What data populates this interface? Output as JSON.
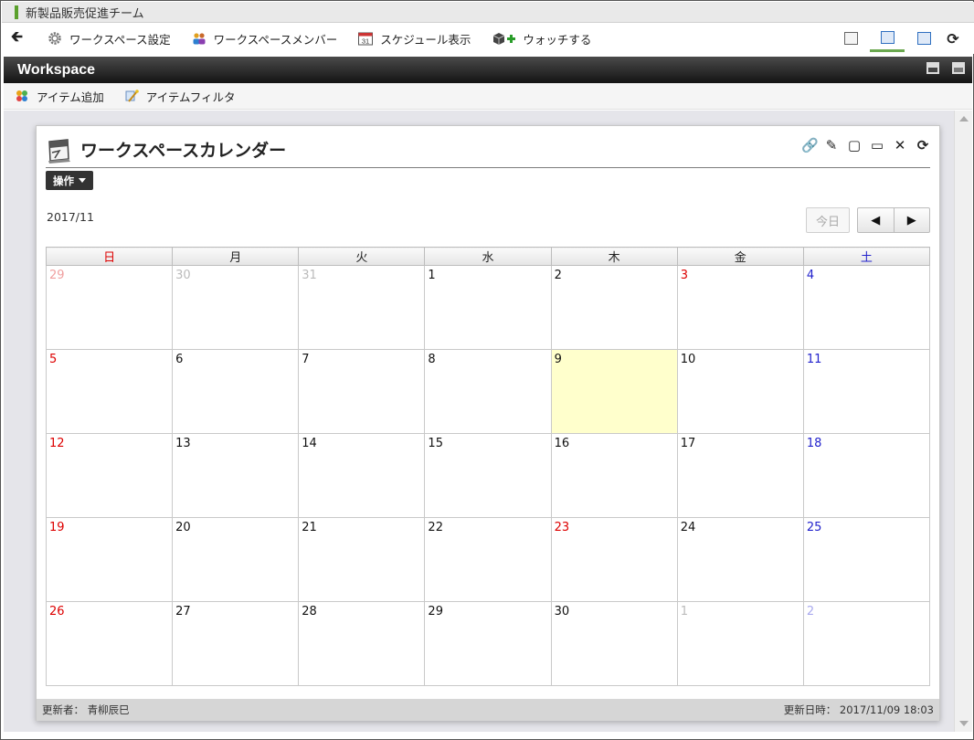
{
  "window": {
    "title": "新製品販売促進チーム"
  },
  "toolbar": {
    "items": [
      {
        "label": "ワークスペース設定"
      },
      {
        "label": "ワークスペースメンバー"
      },
      {
        "label": "スケジュール表示"
      },
      {
        "label": "ウォッチする"
      }
    ],
    "calendar_icon_day": "31"
  },
  "workspace": {
    "title": "Workspace",
    "tools": [
      {
        "label": "アイテム追加"
      },
      {
        "label": "アイテムフィルタ"
      }
    ]
  },
  "portlet": {
    "title": "ワークスペースカレンダー",
    "ops_label": "操作",
    "month_label": "2017/11",
    "today_label": "今日",
    "prev_symbol": "◀",
    "next_symbol": "▶",
    "weekdays": [
      "日",
      "月",
      "火",
      "水",
      "木",
      "金",
      "土"
    ],
    "weeks": [
      [
        {
          "day": "29",
          "kind": "other sun"
        },
        {
          "day": "30",
          "kind": "other"
        },
        {
          "day": "31",
          "kind": "other"
        },
        {
          "day": "1",
          "kind": ""
        },
        {
          "day": "2",
          "kind": ""
        },
        {
          "day": "3",
          "kind": "hol"
        },
        {
          "day": "4",
          "kind": "sat"
        }
      ],
      [
        {
          "day": "5",
          "kind": "sun"
        },
        {
          "day": "6",
          "kind": ""
        },
        {
          "day": "7",
          "kind": ""
        },
        {
          "day": "8",
          "kind": ""
        },
        {
          "day": "9",
          "kind": "today"
        },
        {
          "day": "10",
          "kind": ""
        },
        {
          "day": "11",
          "kind": "sat"
        }
      ],
      [
        {
          "day": "12",
          "kind": "sun"
        },
        {
          "day": "13",
          "kind": ""
        },
        {
          "day": "14",
          "kind": ""
        },
        {
          "day": "15",
          "kind": ""
        },
        {
          "day": "16",
          "kind": ""
        },
        {
          "day": "17",
          "kind": ""
        },
        {
          "day": "18",
          "kind": "sat"
        }
      ],
      [
        {
          "day": "19",
          "kind": "sun"
        },
        {
          "day": "20",
          "kind": ""
        },
        {
          "day": "21",
          "kind": ""
        },
        {
          "day": "22",
          "kind": ""
        },
        {
          "day": "23",
          "kind": "hol"
        },
        {
          "day": "24",
          "kind": ""
        },
        {
          "day": "25",
          "kind": "sat"
        }
      ],
      [
        {
          "day": "26",
          "kind": "sun"
        },
        {
          "day": "27",
          "kind": ""
        },
        {
          "day": "28",
          "kind": ""
        },
        {
          "day": "29",
          "kind": ""
        },
        {
          "day": "30",
          "kind": ""
        },
        {
          "day": "1",
          "kind": "other"
        },
        {
          "day": "2",
          "kind": "other sat"
        }
      ]
    ],
    "footer": {
      "updated_by": "更新者： 青柳辰巳",
      "updated_at": "更新日時： 2017/11/09 18:03"
    }
  },
  "colors": {
    "accent_green": "#6aa84f",
    "sunday_red": "#dd0000",
    "saturday_blue": "#2222cc",
    "today_highlight": "#ffffcc",
    "header_dark": "#141414"
  }
}
